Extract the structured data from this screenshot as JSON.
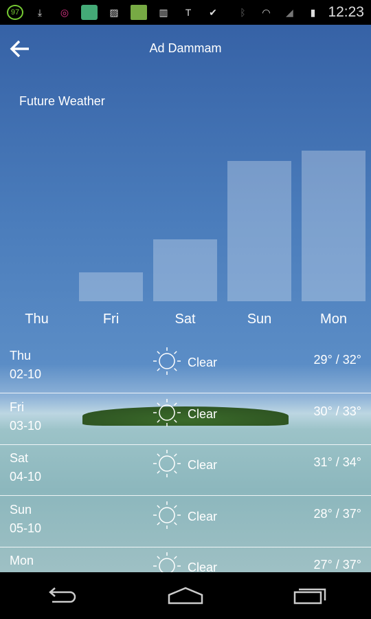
{
  "status_bar": {
    "time": "12:23",
    "battery_badge": "97",
    "icons": [
      "battery-97-icon",
      "download-icon",
      "target-icon",
      "battery-app-icon",
      "image-icon",
      "app-icon",
      "barcode-icon",
      "sim-icon",
      "store-icon",
      "bluetooth-icon",
      "wifi-icon",
      "signal-icon",
      "battery-charging-icon"
    ]
  },
  "header": {
    "title": "Ad Dammam"
  },
  "section_title": "Future Weather",
  "chart_data": {
    "type": "bar",
    "categories": [
      "Thu",
      "Fri",
      "Sat",
      "Sun",
      "Mon"
    ],
    "values": [
      0,
      0.19,
      0.41,
      0.93,
      1.0
    ],
    "title": "",
    "xlabel": "",
    "ylabel": "",
    "grid": false
  },
  "forecast": [
    {
      "day": "Thu",
      "date": "02-10",
      "condition": "Clear",
      "temp": "29° / 32°"
    },
    {
      "day": "Fri",
      "date": "03-10",
      "condition": "Clear",
      "temp": "30° / 33°"
    },
    {
      "day": "Sat",
      "date": "04-10",
      "condition": "Clear",
      "temp": "31° / 34°"
    },
    {
      "day": "Sun",
      "date": "05-10",
      "condition": "Clear",
      "temp": "28° / 37°"
    },
    {
      "day": "Mon",
      "date": "",
      "condition": "Clear",
      "temp": "27° / 37°"
    }
  ],
  "colors": {
    "sky": "#3662a6",
    "bar": "rgba(255,255,255,0.28)"
  }
}
